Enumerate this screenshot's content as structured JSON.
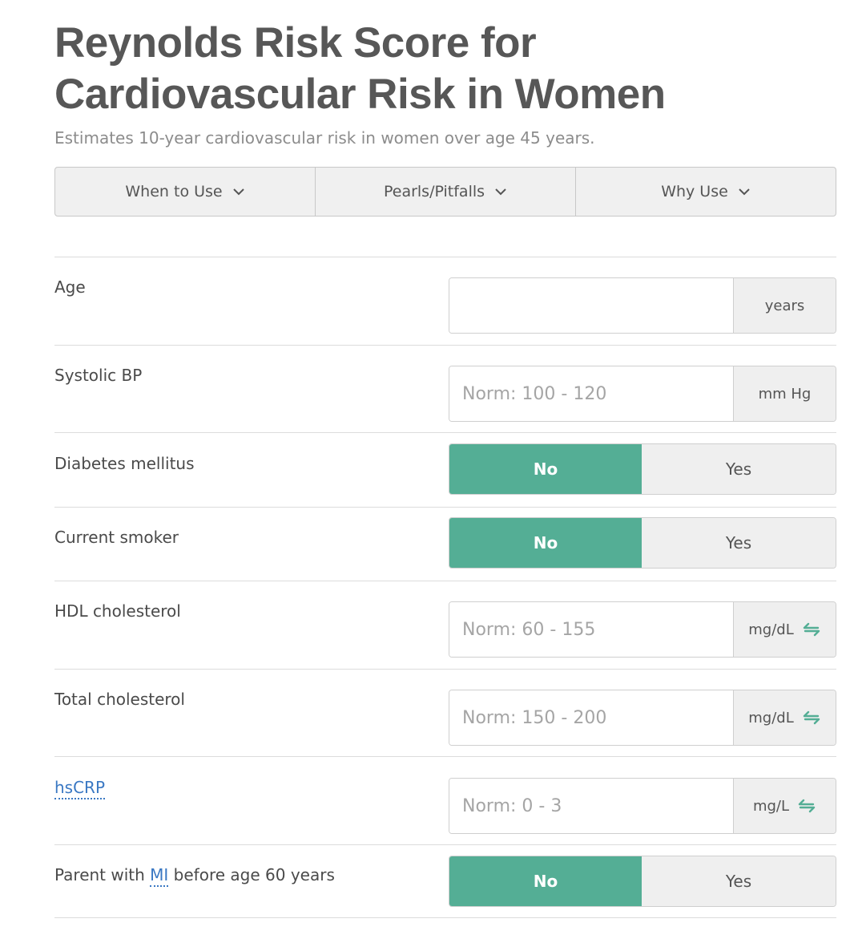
{
  "header": {
    "title": "Reynolds Risk Score for Cardiovascular Risk in Women",
    "subtitle": "Estimates 10-year cardiovascular risk in women over age 45 years."
  },
  "tabs": [
    {
      "label": "When to Use",
      "icon": "chevron-down-icon"
    },
    {
      "label": "Pearls/Pitfalls",
      "icon": "chevron-down-icon"
    },
    {
      "label": "Why Use",
      "icon": "chevron-down-icon"
    }
  ],
  "fields": {
    "age": {
      "label": "Age",
      "value": "",
      "placeholder": "",
      "unit": "years"
    },
    "sbp": {
      "label": "Systolic BP",
      "value": "",
      "placeholder": "Norm: 100 - 120",
      "unit": "mm Hg"
    },
    "diabetes": {
      "label": "Diabetes mellitus",
      "options": [
        "No",
        "Yes"
      ],
      "selected": "No"
    },
    "smoker": {
      "label": "Current smoker",
      "options": [
        "No",
        "Yes"
      ],
      "selected": "No"
    },
    "hdl": {
      "label": "HDL cholesterol",
      "value": "",
      "placeholder": "Norm: 60 - 155",
      "unit": "mg/dL",
      "icon": "unit-swap-icon"
    },
    "total_chol": {
      "label": "Total cholesterol",
      "value": "",
      "placeholder": "Norm: 150 - 200",
      "unit": "mg/dL",
      "icon": "unit-swap-icon"
    },
    "hscrp": {
      "label": "hsCRP",
      "value": "",
      "placeholder": "Norm: 0 - 3",
      "unit": "mg/L",
      "icon": "unit-swap-icon"
    },
    "parent_mi": {
      "label_pre": "Parent with ",
      "label_link": "MI",
      "label_post": " before age 60 years",
      "options": [
        "No",
        "Yes"
      ],
      "selected": "No"
    }
  },
  "colors": {
    "accent": "#54ae95",
    "link": "#3a78c3",
    "title": "#575757"
  }
}
